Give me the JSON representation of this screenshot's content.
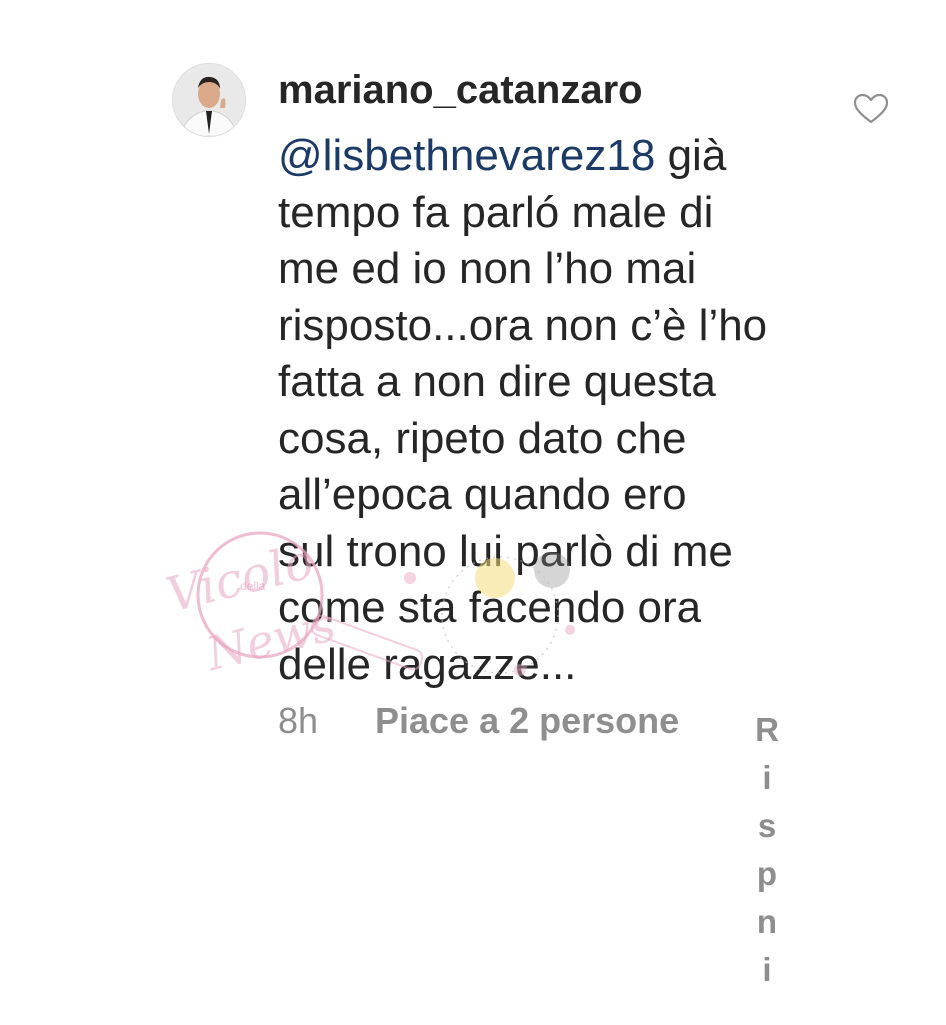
{
  "comment": {
    "username": "mariano_catanzaro",
    "mention": "@lisbethnevarez18",
    "first_line_rest": " già",
    "lines": [
      "tempo fa parló male di",
      "me ed io non l’ho mai",
      "risposto...ora non c’è l’ho",
      "fatta a non dire questa",
      "cosa, ripeto dato che",
      "all’epoca quando ero",
      "sul trono lui parlò di me",
      "come sta facendo ora",
      "delle ragazze..."
    ],
    "time": "8h",
    "likes": "Piace a 2 persone",
    "reply_letters": [
      "R",
      "i",
      "s",
      "p",
      "n",
      "i"
    ]
  },
  "watermark": {
    "text": "Vicolo della News"
  },
  "colors": {
    "text": "#262626",
    "mention": "#1b3a67",
    "meta": "#8e8e8e",
    "watermark_pink": "#e9a6c2"
  },
  "icons": {
    "like": "heart-outline-icon",
    "avatar": "profile-photo"
  }
}
